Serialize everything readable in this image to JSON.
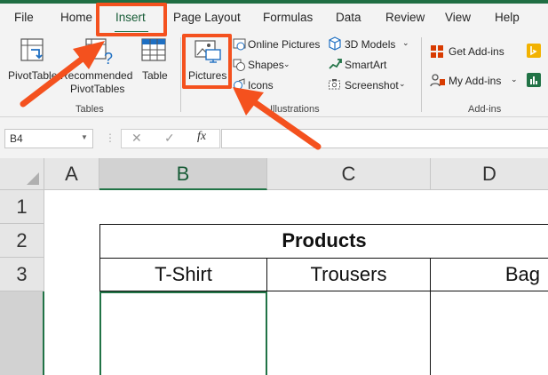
{
  "ribbon_tabs": [
    "File",
    "Home",
    "Insert",
    "Page Layout",
    "Formulas",
    "Data",
    "Review",
    "View",
    "Help"
  ],
  "tables_group": {
    "pivottable_label": "PivotTable",
    "recommended_line1": "Recommended",
    "recommended_line2": "PivotTables",
    "table_label": "Table",
    "group_label": "Tables"
  },
  "illustrations_group": {
    "pictures_label": "Pictures",
    "online_pictures_label": "Online Pictures",
    "shapes_label": "Shapes",
    "icons_label": "Icons",
    "models_3d_label": "3D Models",
    "smartart_label": "SmartArt",
    "screenshot_label": "Screenshot",
    "group_label": "Illustrations"
  },
  "addins_group": {
    "get_addins_label": "Get Add-ins",
    "my_addins_label": "My Add-ins",
    "group_label": "Add-ins"
  },
  "formula_bar": {
    "name_box_value": "B4",
    "cancel_symbol": "✕",
    "enter_symbol": "✓",
    "fx_symbol": "fx",
    "formula_value": ""
  },
  "sheet": {
    "columns": [
      "A",
      "B",
      "C",
      "D"
    ],
    "rows": [
      "1",
      "2",
      "3"
    ],
    "title": "Products",
    "headers": [
      "T-Shirt",
      "Trousers",
      "Bag"
    ]
  },
  "colors": {
    "excel_green": "#217346",
    "annotation_orange": "#f4511e",
    "ribbon_bg": "#f3f3f3"
  }
}
